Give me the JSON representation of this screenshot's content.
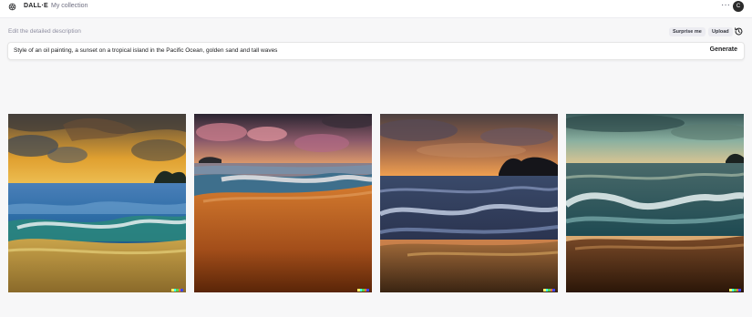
{
  "header": {
    "brand": "DALL·E",
    "collection_link": "My collection",
    "more_label": "···",
    "avatar_initial": "C"
  },
  "editor": {
    "description_label": "Edit the detailed description",
    "surprise_label": "Surprise me",
    "upload_label": "Upload",
    "prompt_text": "Style of an oil painting, a sunset on a tropical island in the Pacific Ocean, golden sand and tall waves",
    "generate_label": "Generate"
  },
  "results": {
    "images": [
      {
        "subject": "oil painting sunset over tropical island, blue waves"
      },
      {
        "subject": "oil painting sunset, pink clouds, orange sand beach"
      },
      {
        "subject": "oil painting dusk, island silhouette, dark waves"
      },
      {
        "subject": "oil painting sunset, teal breaking waves, dark sand"
      }
    ],
    "signature_colors": [
      "#ffff66",
      "#42ffff",
      "#51da4c",
      "#ff6e3c",
      "#3c46ff"
    ]
  }
}
